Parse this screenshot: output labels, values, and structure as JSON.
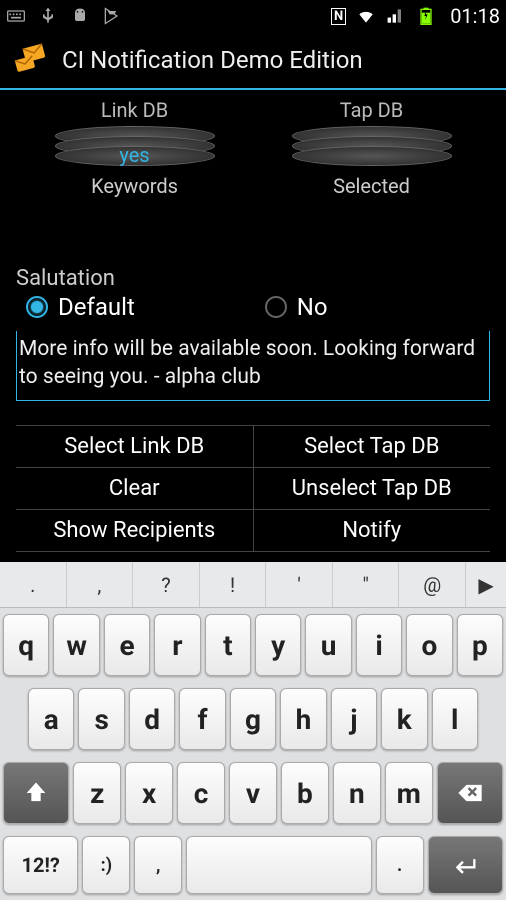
{
  "status": {
    "clock": "01:18",
    "icons_left": [
      "keyboard-icon",
      "usb-icon",
      "android-icon",
      "play-store-icon"
    ],
    "icons_right": [
      "nfc-icon",
      "wifi-icon",
      "signal-icon",
      "battery-icon"
    ]
  },
  "app": {
    "title": "CI Notification Demo Edition"
  },
  "db": {
    "link": {
      "label": "Link DB",
      "value": "yes",
      "sub": "Keywords"
    },
    "tap": {
      "label": "Tap DB",
      "value": "",
      "sub": "Selected"
    }
  },
  "salutation": {
    "label": "Salutation",
    "options": [
      {
        "label": "Default",
        "checked": true
      },
      {
        "label": "No",
        "checked": false
      }
    ]
  },
  "message": "More info will be available soon. Looking forward to seeing you. - alpha club",
  "buttons": {
    "select_link": "Select Link DB",
    "select_tap": "Select Tap DB",
    "clear": "Clear",
    "unselect_tap": "Unselect Tap DB",
    "show_recipients": "Show Recipients",
    "notify": "Notify"
  },
  "keyboard": {
    "symrow": [
      ".",
      ",",
      "?",
      "!",
      "'",
      "\"",
      "@"
    ],
    "row1": [
      "q",
      "w",
      "e",
      "r",
      "t",
      "y",
      "u",
      "i",
      "o",
      "p"
    ],
    "row2": [
      "a",
      "s",
      "d",
      "f",
      "g",
      "h",
      "j",
      "k",
      "l"
    ],
    "row3": [
      "z",
      "x",
      "c",
      "v",
      "b",
      "n",
      "m"
    ],
    "mode": "12!?",
    "emoji": ":)",
    "comma": ",",
    "period": "."
  }
}
